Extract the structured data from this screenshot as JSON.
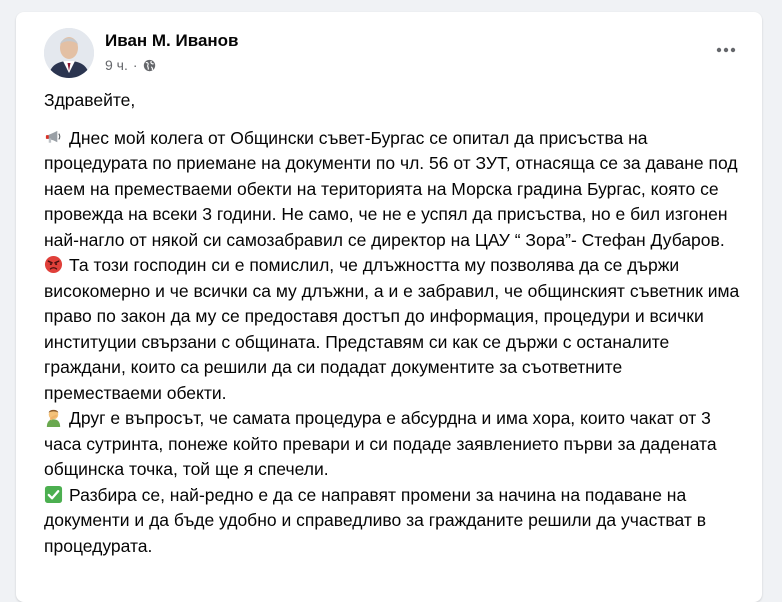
{
  "post": {
    "author": "Иван М. Иванов",
    "time": "9 ч.",
    "dot": "·",
    "greeting": "Здравейте,",
    "paragraphs": [
      {
        "icon": "megaphone-icon",
        "text": "Днес мой колега от Общински съвет-Бургас се опитал да присъства на процедурата по приемане на документи по чл. 56 от ЗУТ, отнасяща се за даване под наем на преместваеми обекти на територията на Морска градина Бургас, която се провежда на всеки 3 години. Не само, че не е успял да присъства, но е бил изгонен най-нагло от някой си самозабравил се директор на ЦАУ “ Зора”- Стефан Дубаров."
      },
      {
        "icon": "angry-face-icon",
        "text": "Та този господин си е помислил, че длъжността му позволява да се държи високомерно и че всички са му длъжни, а и е забравил, че общинският съветник има право по закон да му се предоставя достъп до информация, процедури и всички институции свързани с общината. Представям си как се държи с останалите граждани, които са решили да си подадат документите за съответните преместваеми обекти."
      },
      {
        "icon": "facepalm-icon",
        "text": "Друг е въпросът, че самата процедура е абсурдна и има хора, които чакат от 3 часа сутринта, понеже който превари и си подаде заявлението първи за дадената общинска точка, той ще я спечели."
      },
      {
        "icon": "check-mark-icon",
        "text": "Разбира се, най-редно е да се направят промени за начина на подаване на документи и да бъде удобно и справедливо за гражданите решили да участват в процедурата."
      }
    ]
  }
}
